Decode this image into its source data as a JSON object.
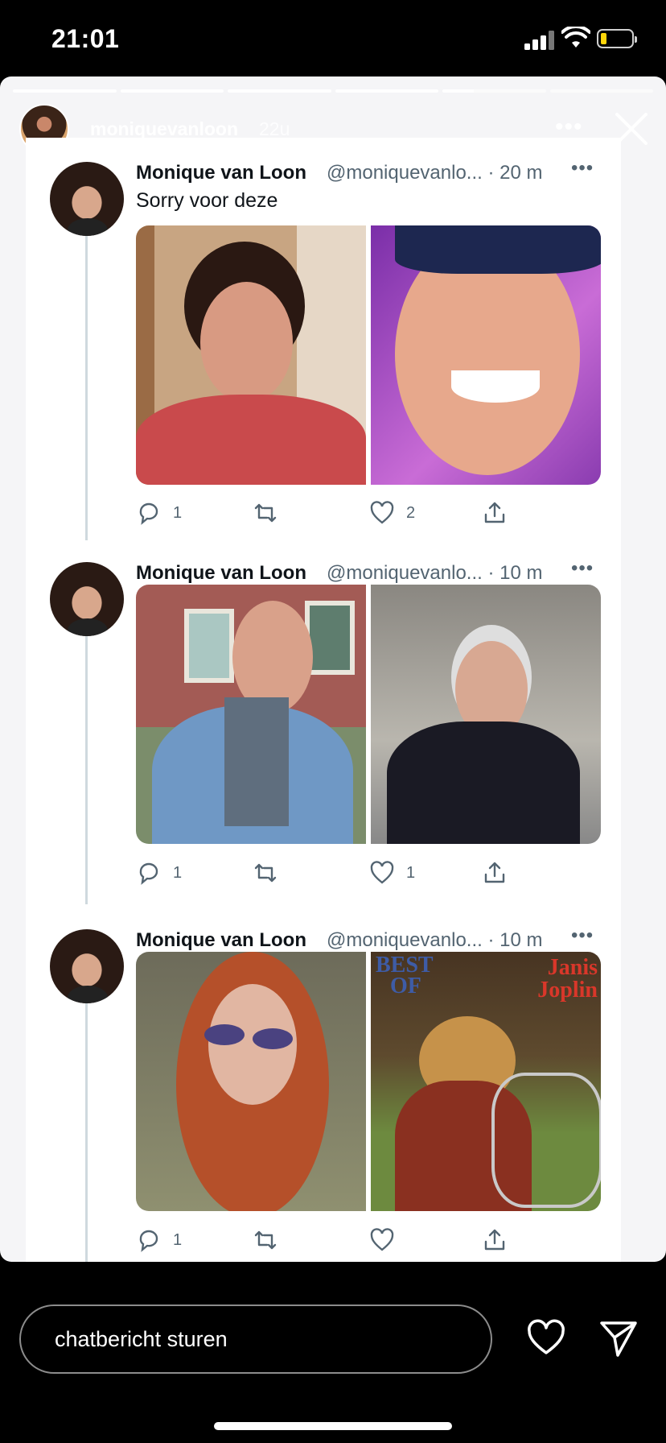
{
  "status_bar": {
    "time": "21:01"
  },
  "story": {
    "username": "moniquevanloon",
    "age": "22u",
    "more_label": "•••",
    "progress": [
      1,
      1,
      1,
      1,
      0.3,
      0
    ]
  },
  "tweets": [
    {
      "name": "Monique van Loon",
      "handle": "@moniquevanlo... · 20 m",
      "more": "•••",
      "text": "Sorry voor deze",
      "replies": "1",
      "likes": "2"
    },
    {
      "name": "Monique van Loon",
      "handle": "@moniquevanlo... · 10 m",
      "more": "•••",
      "replies": "1",
      "likes": "1"
    },
    {
      "name": "Monique van Loon",
      "handle": "@moniquevanlo... · 10 m",
      "more": "•••",
      "replies": "1",
      "likes": ""
    }
  ],
  "album_art": {
    "line1": "BEST",
    "line2": "OF",
    "artist1": "Janis",
    "artist2": "Joplin"
  },
  "compose": {
    "placeholder": "chatbericht sturen"
  },
  "colors": {
    "like_heart_outline": "#536471",
    "story_bg": "#f5f5f7"
  }
}
